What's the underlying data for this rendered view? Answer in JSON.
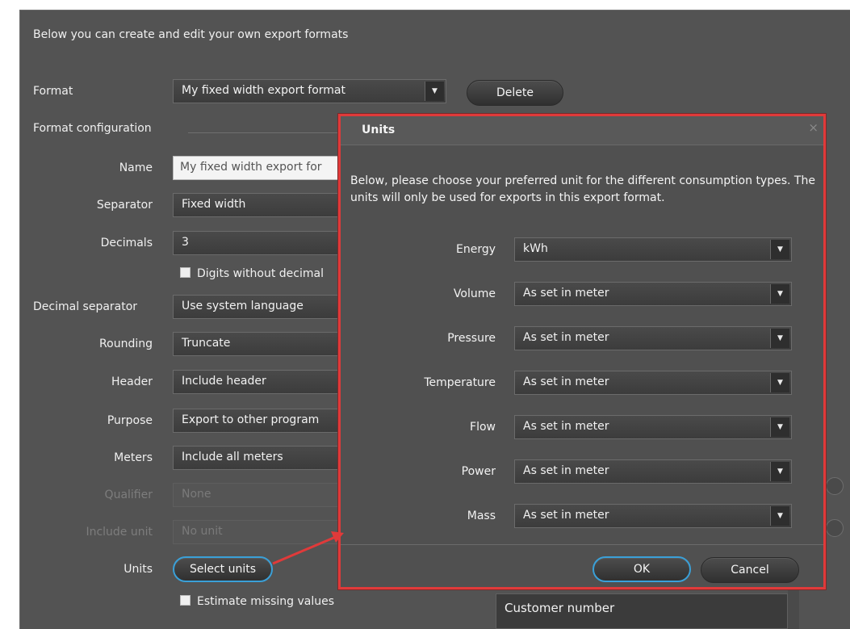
{
  "intro_text": "Below you can create and edit your own export formats",
  "format": {
    "label": "Format",
    "value": "My fixed width export format",
    "delete_label": "Delete"
  },
  "config": {
    "section_label": "Format configuration",
    "name_label": "Name",
    "name_value": "My fixed width export for",
    "separator_label": "Separator",
    "separator_value": "Fixed width",
    "decimals_label": "Decimals",
    "decimals_value": "3",
    "digits_checkbox_label": "Digits without decimal",
    "decimal_separator_label": "Decimal separator",
    "decimal_separator_value": "Use system language",
    "rounding_label": "Rounding",
    "rounding_value": "Truncate",
    "header_label": "Header",
    "header_value": "Include header",
    "purpose_label": "Purpose",
    "purpose_value": "Export to other program",
    "meters_label": "Meters",
    "meters_value": "Include all meters",
    "qualifier_label": "Qualifier",
    "qualifier_value": "None",
    "include_unit_label": "Include unit",
    "include_unit_value": "No unit",
    "units_label": "Units",
    "select_units_label": "Select units",
    "estimate_checkbox_label": "Estimate missing values"
  },
  "customer_number_label": "Customer number",
  "dialog": {
    "title": "Units",
    "close_icon": "×",
    "description": "Below, please choose your preferred unit for the different consumption types. The units will only be used for exports in this export format.",
    "rows": [
      {
        "label": "Energy",
        "value": "kWh"
      },
      {
        "label": "Volume",
        "value": "As set in meter"
      },
      {
        "label": "Pressure",
        "value": "As set in meter"
      },
      {
        "label": "Temperature",
        "value": "As set in meter"
      },
      {
        "label": "Flow",
        "value": "As set in meter"
      },
      {
        "label": "Power",
        "value": "As set in meter"
      },
      {
        "label": "Mass",
        "value": "As set in meter"
      }
    ],
    "ok_label": "OK",
    "cancel_label": "Cancel"
  },
  "colors": {
    "panel_bg": "#535353",
    "highlight_border": "#e03a3a",
    "focus_ring": "#3aa0d8"
  }
}
